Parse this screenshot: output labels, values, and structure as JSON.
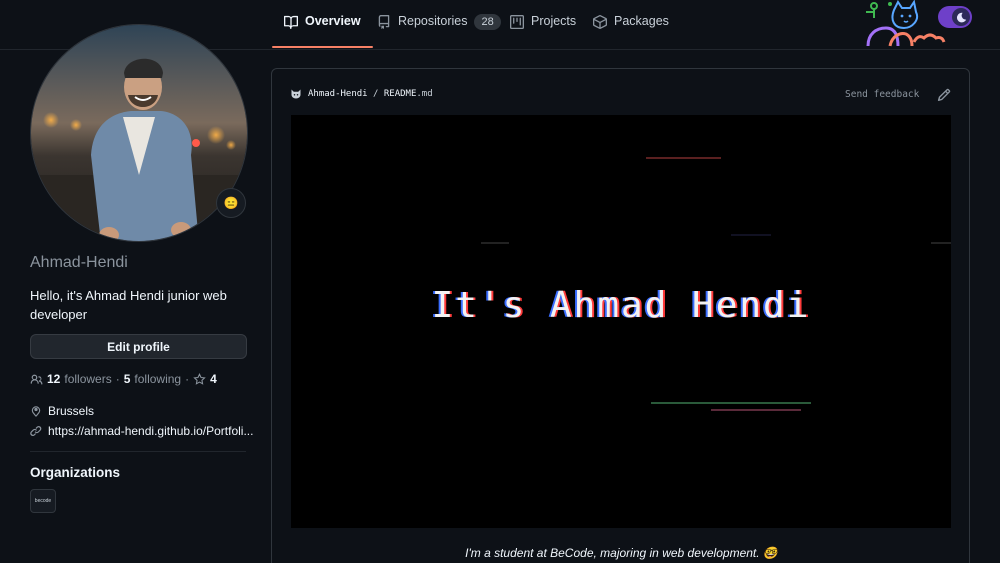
{
  "nav": {
    "tabs": [
      {
        "label": "Overview",
        "icon": "book-icon"
      },
      {
        "label": "Repositories",
        "icon": "repo-icon",
        "count": "28"
      },
      {
        "label": "Projects",
        "icon": "project-icon"
      },
      {
        "label": "Packages",
        "icon": "package-icon"
      }
    ],
    "theme_toggle_icon": "moon-icon"
  },
  "profile": {
    "username": "Ahmad-Hendi",
    "bio": "Hello, it's Ahmad Hendi junior web developer",
    "status_emoji": "😑",
    "edit_label": "Edit profile",
    "followers_count": "12",
    "followers_label": "followers",
    "separator": "·",
    "following_count": "5",
    "following_label": "following",
    "separator2": "·",
    "stars_count": "4",
    "location": "Brussels",
    "website": "https://ahmad-hendi.github.io/Portfoli..."
  },
  "organizations": {
    "title": "Organizations",
    "org_badge_text": "becode"
  },
  "readme": {
    "owner": "Ahmad-Hendi",
    "slash": "/",
    "filename": "README",
    "ext": ".md",
    "feedback_label": "Send feedback",
    "banner_text": "It's Ahmad Hendi",
    "caption": "I'm a student at BeCode, majoring in web development. 🤓"
  },
  "colors": {
    "background": "#0d1117",
    "border": "#30363d",
    "accent_underline": "#f78166",
    "toggle": "#6e40c9"
  }
}
